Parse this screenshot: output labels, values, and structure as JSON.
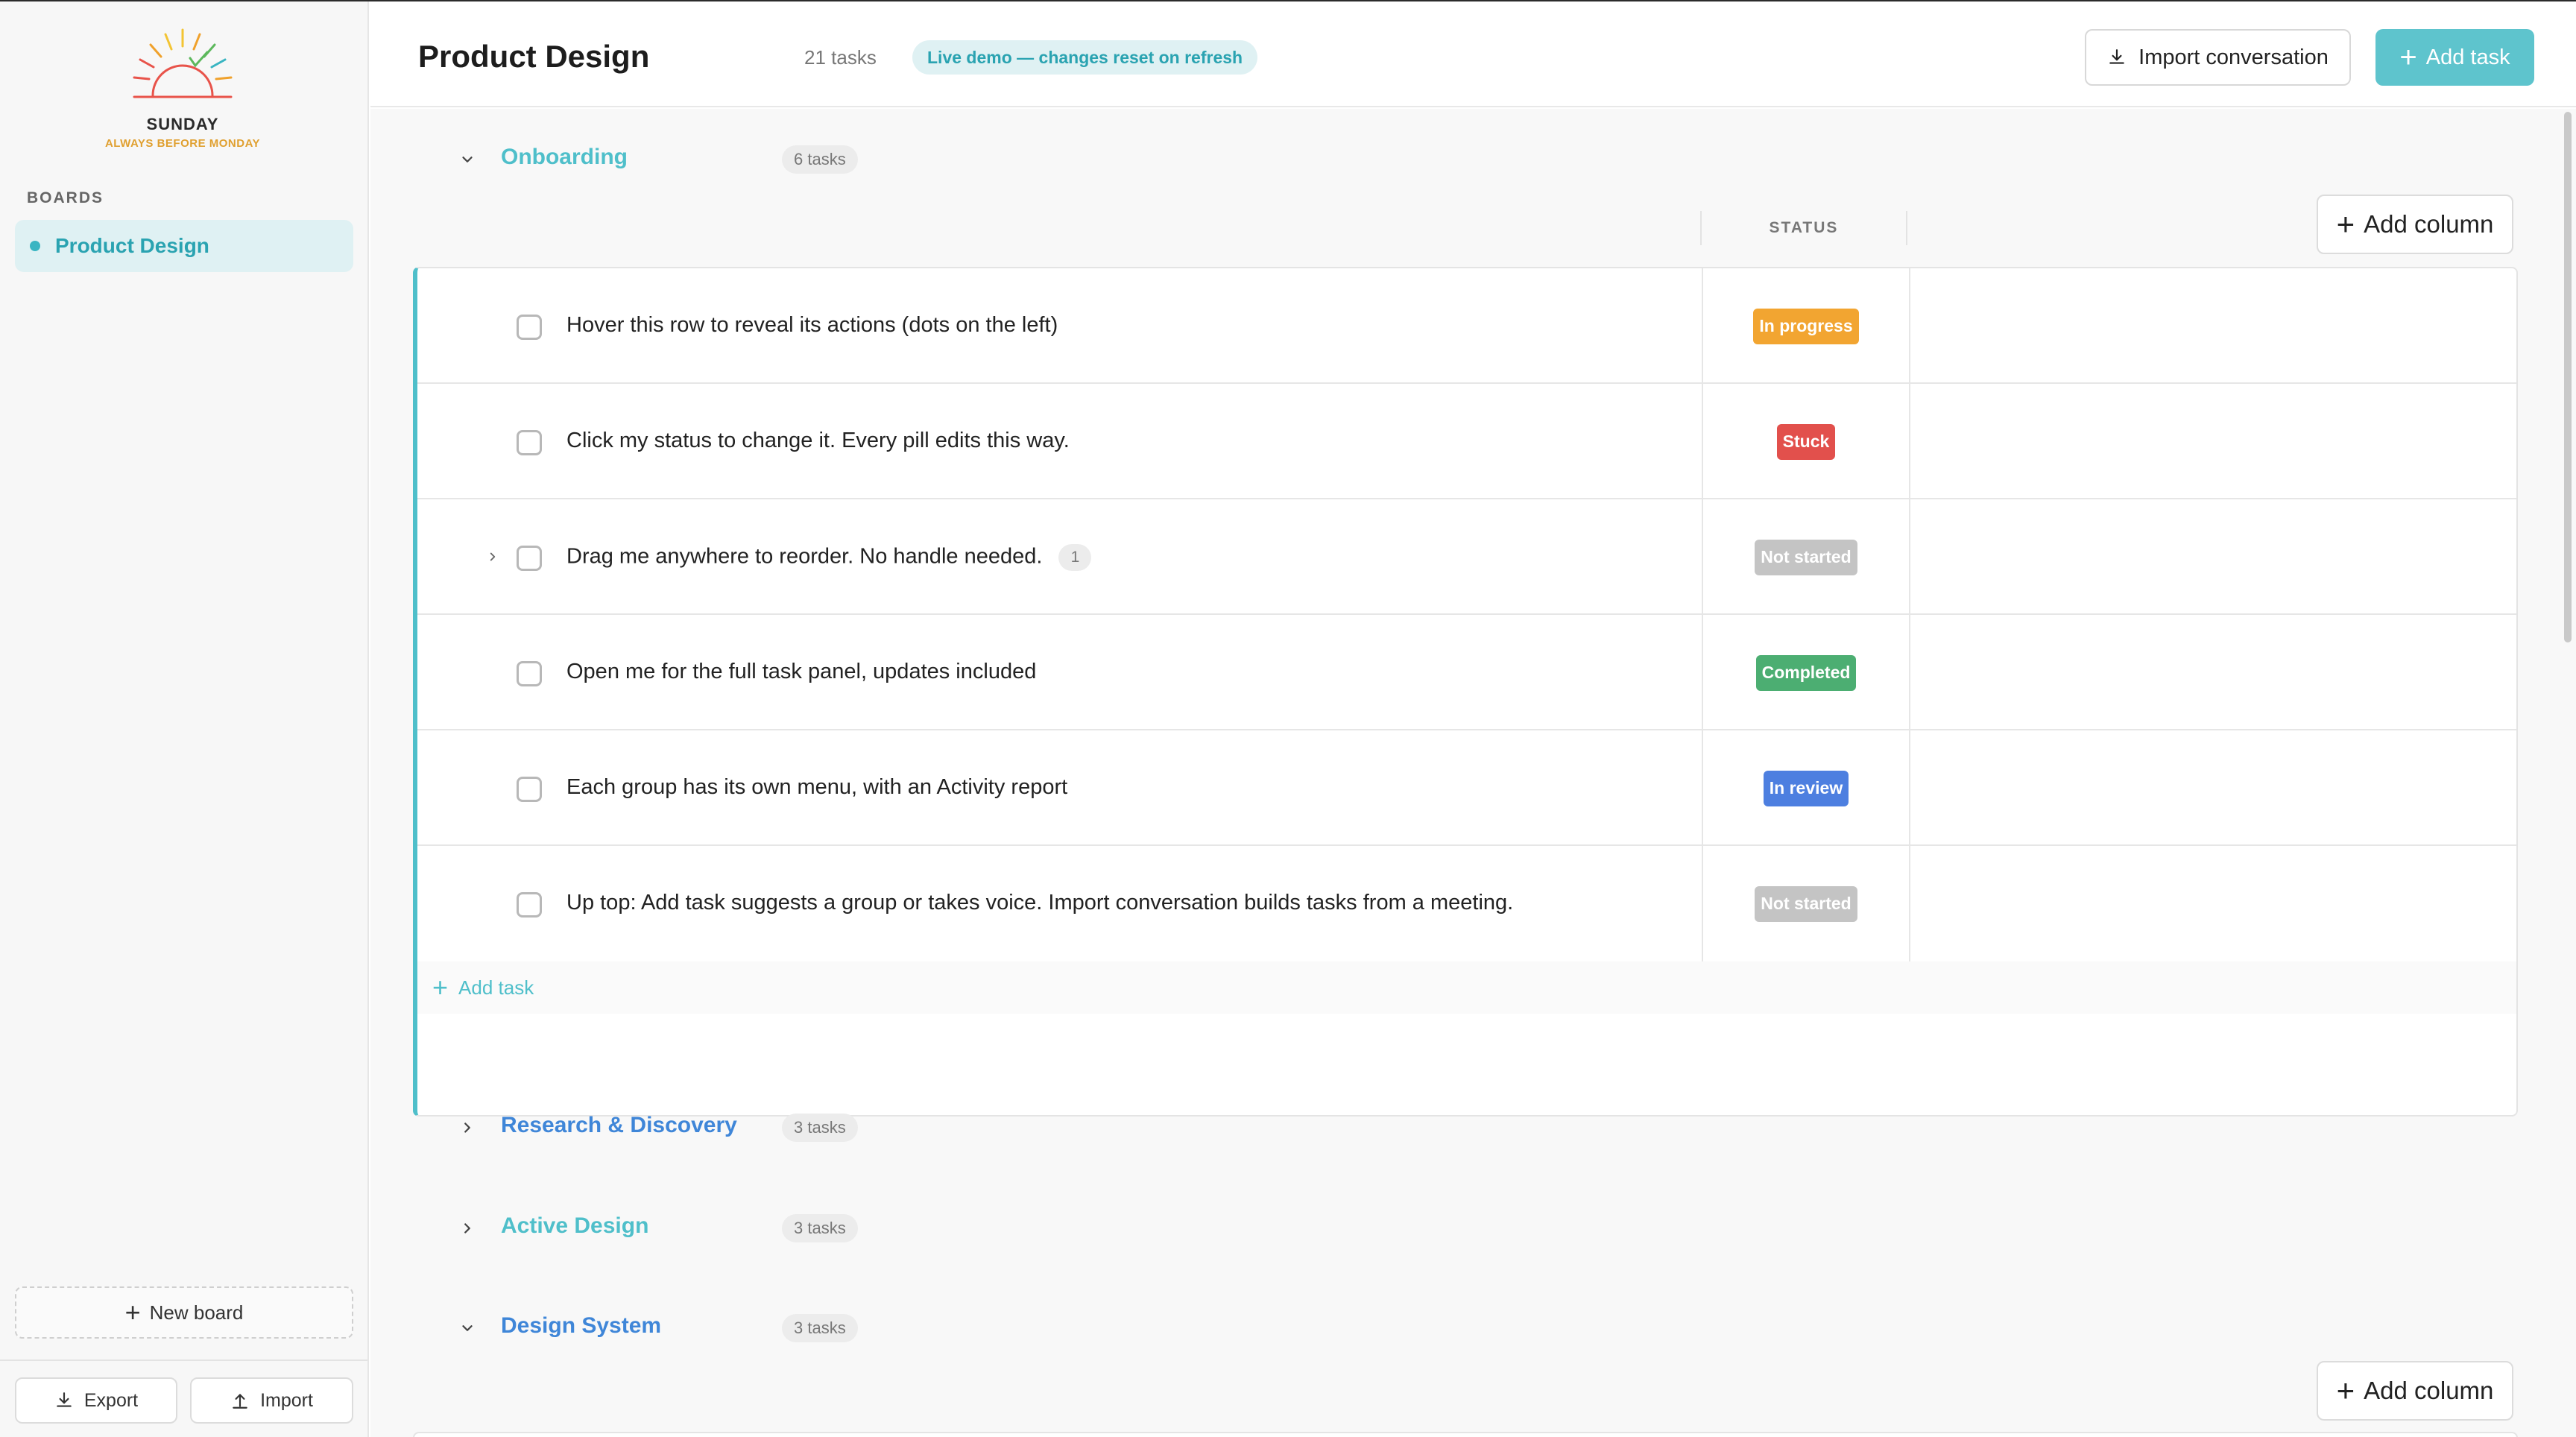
{
  "brand": {
    "name": "SUNDAY",
    "tagline": "ALWAYS BEFORE MONDAY",
    "sun_colors": [
      "#e8534a",
      "#f0a12b",
      "#f3c433",
      "#5cb85c",
      "#39b5c2"
    ]
  },
  "sidebar": {
    "boards_heading": "BOARDS",
    "boards": [
      {
        "label": "Product Design",
        "active": true
      }
    ],
    "new_board_label": "New board",
    "export_label": "Export",
    "import_label": "Import"
  },
  "header": {
    "title": "Product Design",
    "task_count": "21 tasks",
    "demo_badge": "Live demo — changes reset on refresh",
    "import_conversation_label": "Import conversation",
    "add_task_label": "Add task"
  },
  "columns": {
    "status_header": "STATUS",
    "add_column_label": "Add column"
  },
  "groups": [
    {
      "name": "Onboarding",
      "count": "6 tasks",
      "expanded": true,
      "color": "#4fbfca",
      "tasks": [
        {
          "text": "Hover this row to reveal its actions (dots on the left)",
          "status": "In progress",
          "status_color": "#f2a531"
        },
        {
          "text": "Click my status to change it. Every pill edits this way.",
          "status": "Stuck",
          "status_color": "#e2504c"
        },
        {
          "text": "Drag me anywhere to reorder. No handle needed.",
          "subtasks": "1",
          "status": "Not started",
          "status_color": "#c4c4c4"
        },
        {
          "text": "Open me for the full task panel, updates included",
          "status": "Completed",
          "status_color": "#4cae72"
        },
        {
          "text": "Each group has its own menu, with an Activity report",
          "status": "In review",
          "status_color": "#4d7fe0"
        },
        {
          "text": "Up top: Add task suggests a group or takes voice. Import conversation builds tasks from a meeting.",
          "status": "Not started",
          "status_color": "#c4c4c4"
        }
      ],
      "add_task_label": "Add task"
    },
    {
      "name": "Research & Discovery",
      "count": "3 tasks",
      "expanded": false,
      "color": "#3f86d8"
    },
    {
      "name": "Active Design",
      "count": "3 tasks",
      "expanded": false,
      "color": "#4fbfca"
    },
    {
      "name": "Design System",
      "count": "3 tasks",
      "expanded": true,
      "color": "#3f86d8"
    }
  ]
}
